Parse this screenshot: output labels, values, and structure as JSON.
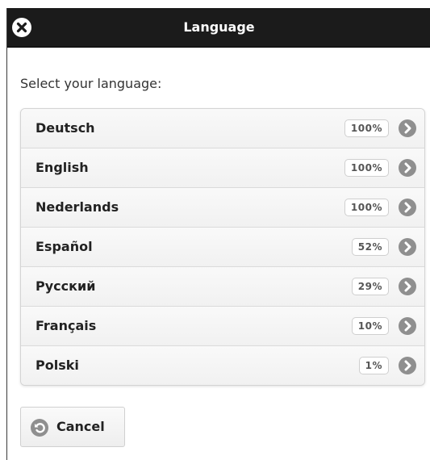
{
  "header": {
    "title": "Language",
    "close_icon": "close-icon"
  },
  "prompt": "Select your language:",
  "languages": [
    {
      "label": "Deutsch",
      "percent": "100%"
    },
    {
      "label": "English",
      "percent": "100%"
    },
    {
      "label": "Nederlands",
      "percent": "100%"
    },
    {
      "label": "Español",
      "percent": "52%"
    },
    {
      "label": "Русский",
      "percent": "29%"
    },
    {
      "label": "Français",
      "percent": "10%"
    },
    {
      "label": "Polski",
      "percent": "1%"
    }
  ],
  "cancel": {
    "label": "Cancel",
    "icon": "back-arrow-icon"
  },
  "colors": {
    "header_bg": "#1b1b1b",
    "header_text": "#ffffff",
    "list_bg": "#f6f6f6",
    "icon_gray": "#8f8f8f"
  }
}
